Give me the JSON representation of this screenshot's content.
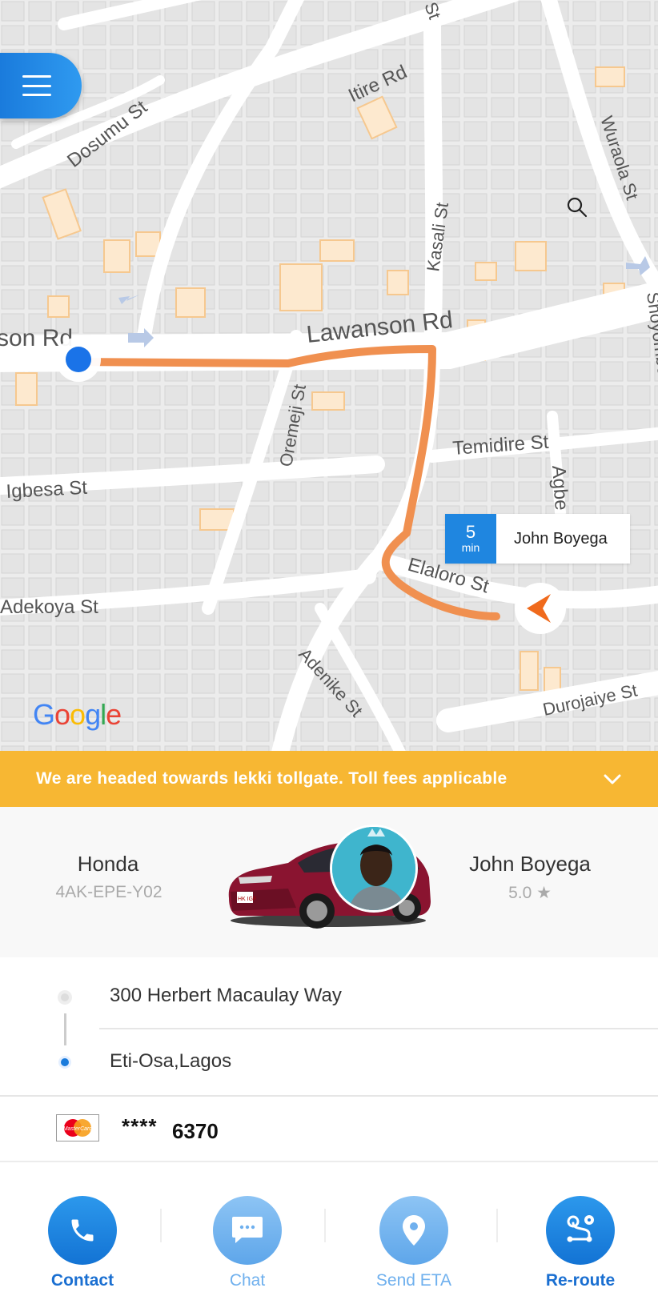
{
  "map": {
    "streets": [
      "Dosumu St",
      "Itire Rd",
      "Wuraola St",
      "Kasali St",
      "Lawanson Rd",
      "son Rd",
      "Oremeji St",
      "Temidire St",
      "Agbe",
      "Igbesa St",
      "Elaloro St",
      "Adekoya St",
      "Adenike St",
      "Durojaiye St",
      "Shoyombo",
      "St"
    ],
    "google_logo": [
      "G",
      "o",
      "o",
      "g",
      "l",
      "e"
    ],
    "colors": {
      "route": "#f09050",
      "user_dot": "#1a73e8",
      "driver_arrow": "#f06a1c"
    }
  },
  "eta_chip": {
    "minutes": "5",
    "unit": "min",
    "driver": "John Boyega"
  },
  "banner": {
    "text": "We are headed towards lekki tollgate. Toll fees applicable",
    "icon": "chevron-down-icon"
  },
  "vehicle": {
    "make": "Honda",
    "plate": "4AK-EPE-Y02",
    "plate_badge": "HK IGF"
  },
  "driver": {
    "name": "John Boyega",
    "rating": "5.0 ★"
  },
  "trip": {
    "pickup": "300 Herbert Macaulay Way",
    "dropoff": "Eti-Osa,Lagos"
  },
  "payment": {
    "brand_label": "MasterCard",
    "mask": "****",
    "last4": "6370"
  },
  "actions": [
    {
      "label": "Contact",
      "icon": "phone-icon",
      "color": "#1a7bdc"
    },
    {
      "label": "Chat",
      "icon": "chat-bubble-icon",
      "color": "#6fb0ee"
    },
    {
      "label": "Send ETA",
      "icon": "location-pin-icon",
      "color": "#6fb0ee"
    },
    {
      "label": "Re-route",
      "icon": "route-icon",
      "color": "#1a7bdc"
    }
  ]
}
